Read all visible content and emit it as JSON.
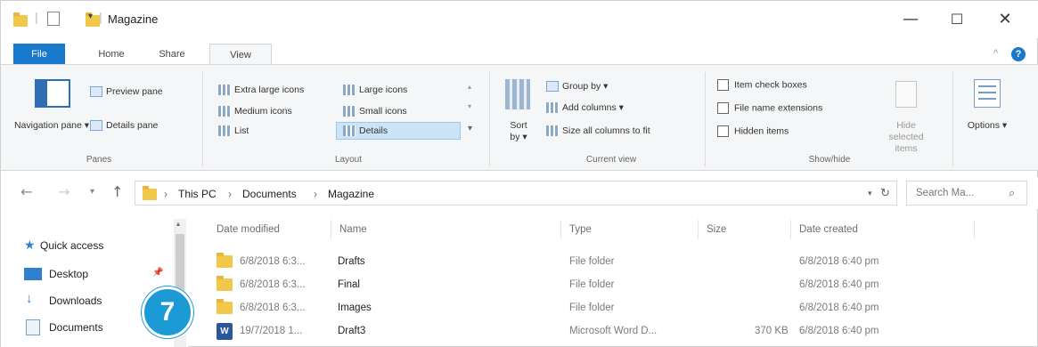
{
  "window": {
    "title": "Magazine",
    "minimize": "—",
    "maximize": "☐",
    "close": "✕"
  },
  "tabs": {
    "file": "File",
    "home": "Home",
    "share": "Share",
    "view": "View"
  },
  "ribbon": {
    "panes": {
      "navigation_pane": "Navigation pane ▾",
      "preview_pane": "Preview pane",
      "details_pane": "Details pane",
      "label": "Panes"
    },
    "layout": {
      "extra_large": "Extra large icons",
      "large": "Large icons",
      "medium": "Medium icons",
      "small": "Small icons",
      "list": "List",
      "details": "Details",
      "label": "Layout"
    },
    "current_view": {
      "sort_by": "Sort by ▾",
      "group_by": "Group by ▾",
      "add_columns": "Add columns ▾",
      "size_all": "Size all columns to fit",
      "label": "Current view"
    },
    "show_hide": {
      "item_check_boxes": "Item check boxes",
      "file_name_extensions": "File name extensions",
      "hidden_items": "Hidden items",
      "hide_selected": "Hide selected items",
      "label": "Show/hide"
    },
    "options": "Options ▾"
  },
  "address": {
    "crumbs": [
      "This PC",
      "Documents",
      "Magazine"
    ],
    "search_placeholder": "Search Ma..."
  },
  "nav": {
    "items": [
      "Quick access",
      "Desktop",
      "Downloads",
      "Documents"
    ]
  },
  "columns": [
    "Date modified",
    "Name",
    "Type",
    "Size",
    "Date created"
  ],
  "rows": [
    {
      "modified": "6/8/2018 6:3...",
      "name": "Drafts",
      "type": "File folder",
      "size": "",
      "created": "6/8/2018 6:40 pm",
      "icon": "folder"
    },
    {
      "modified": "6/8/2018 6:3...",
      "name": "Final",
      "type": "File folder",
      "size": "",
      "created": "6/8/2018 6:40 pm",
      "icon": "folder"
    },
    {
      "modified": "6/8/2018 6:3...",
      "name": "Images",
      "type": "File folder",
      "size": "",
      "created": "6/8/2018 6:40 pm",
      "icon": "folder"
    },
    {
      "modified": "19/7/2018 1...",
      "name": "Draft3",
      "type": "Microsoft Word D...",
      "size": "370 KB",
      "created": "6/8/2018 6:40 pm",
      "icon": "word"
    }
  ],
  "callout": "7",
  "colors": {
    "file_tab": "#1979ca",
    "callout": "#1b9ad6",
    "selection": "#cce4f7",
    "folder": "#f2c84b"
  }
}
